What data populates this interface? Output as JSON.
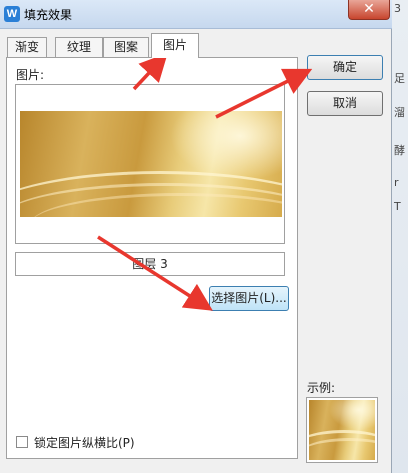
{
  "window": {
    "title": "填充效果",
    "app_icon": "W",
    "close_glyph": "✕"
  },
  "tabs": [
    {
      "label": "渐变",
      "active": false
    },
    {
      "label": "纹理",
      "active": false
    },
    {
      "label": "图案",
      "active": false
    },
    {
      "label": "图片",
      "active": true
    }
  ],
  "picture_tab": {
    "picture_label": "图片:",
    "picture_name": "图层 3",
    "select_button": "选择图片(L)..."
  },
  "lock_aspect": {
    "label": "锁定图片纵横比(P)",
    "checked": false
  },
  "buttons": {
    "ok": "确定",
    "cancel": "取消"
  },
  "sample_label": "示例:",
  "background_window_marks": [
    "3",
    "足",
    "溜",
    "酵",
    "r",
    "T"
  ],
  "colors": {
    "arrow": "#e8372e",
    "gold_dark": "#b8862c",
    "gold_light": "#f6e6a8"
  }
}
